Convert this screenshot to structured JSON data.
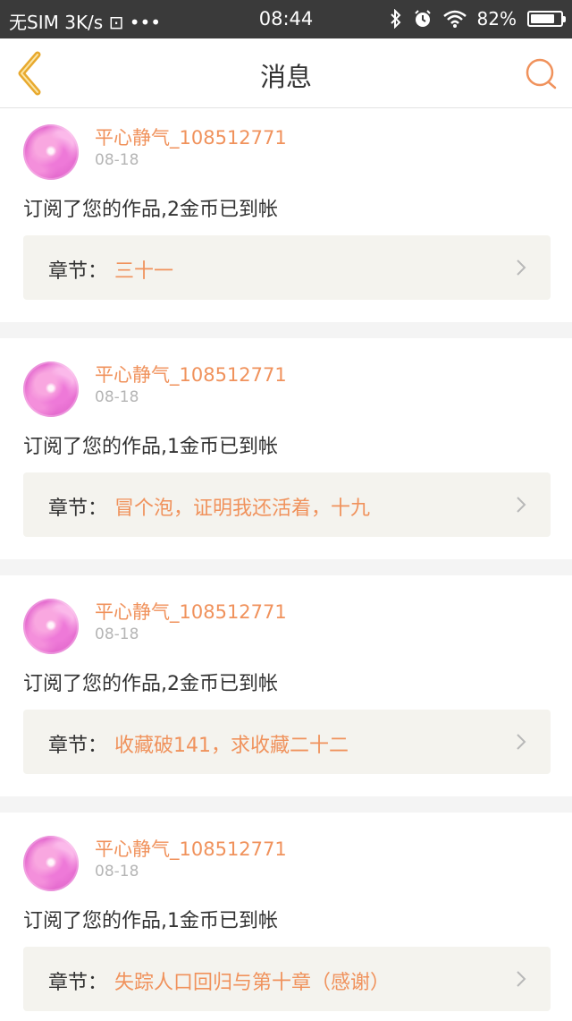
{
  "status_bar": {
    "carrier": "无SIM",
    "speed": "3K/s",
    "extra": "⊡ •••",
    "time": "08:44",
    "battery_text": "82%",
    "battery_level": 0.82
  },
  "nav": {
    "title": "消息"
  },
  "colors": {
    "accent": "#f0925c",
    "back_arrow": "#e8a92e"
  },
  "messages": [
    {
      "user": "平心静气_108512771",
      "date": "08-18",
      "text": "订阅了您的作品,2金币已到帐",
      "chapter_label": "章节：",
      "chapter": "三十一"
    },
    {
      "user": "平心静气_108512771",
      "date": "08-18",
      "text": "订阅了您的作品,1金币已到帐",
      "chapter_label": "章节：",
      "chapter": "冒个泡，证明我还活着，十九"
    },
    {
      "user": "平心静气_108512771",
      "date": "08-18",
      "text": "订阅了您的作品,2金币已到帐",
      "chapter_label": "章节：",
      "chapter": "收藏破141，求收藏二十二"
    },
    {
      "user": "平心静气_108512771",
      "date": "08-18",
      "text": "订阅了您的作品,1金币已到帐",
      "chapter_label": "章节：",
      "chapter": "失踪人口回归与第十章（感谢）"
    }
  ]
}
